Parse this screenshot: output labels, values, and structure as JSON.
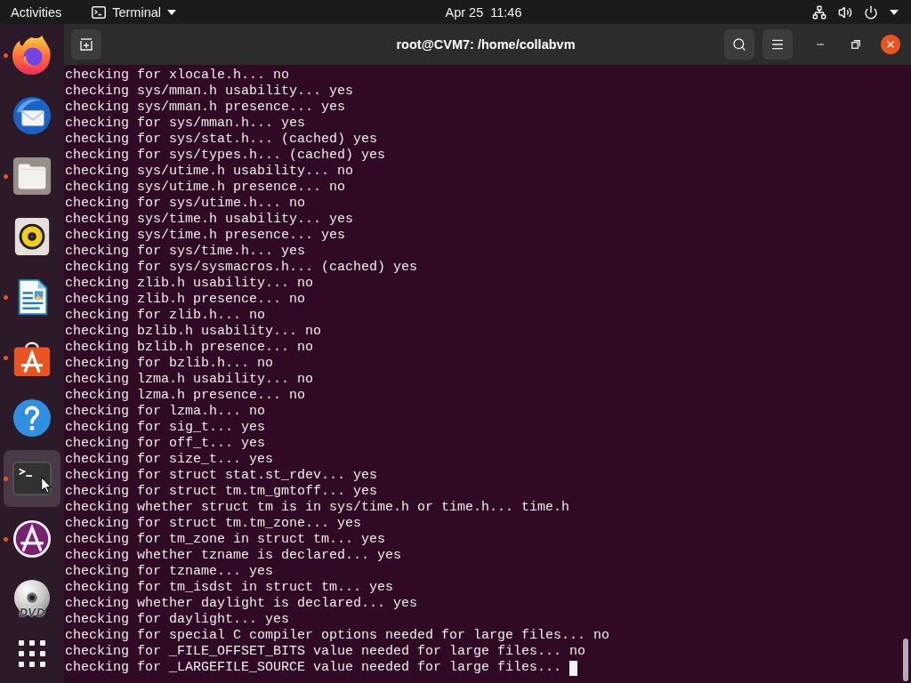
{
  "top_bar": {
    "activities": "Activities",
    "app_menu": "Terminal",
    "clock": "Apr 25  11:46"
  },
  "dock": {
    "items": [
      {
        "kind": "browser",
        "running": true,
        "selected": false
      },
      {
        "kind": "mail",
        "running": false,
        "selected": false
      },
      {
        "kind": "folder",
        "running": true,
        "selected": false
      },
      {
        "kind": "speaker",
        "running": false,
        "selected": false
      },
      {
        "kind": "document",
        "running": true,
        "selected": false
      },
      {
        "kind": "shop",
        "running": true,
        "selected": false
      },
      {
        "kind": "help",
        "running": false,
        "selected": false
      },
      {
        "kind": "terminal",
        "running": true,
        "selected": true
      },
      {
        "kind": "emblem",
        "running": true,
        "selected": false
      },
      {
        "kind": "disc",
        "running": false,
        "selected": false,
        "label": "DVD"
      }
    ]
  },
  "window": {
    "title": "root@CVM7: /home/collabvm"
  },
  "terminal": {
    "lines": [
      "checking for xlocale.h... no",
      "checking sys/mman.h usability... yes",
      "checking sys/mman.h presence... yes",
      "checking for sys/mman.h... yes",
      "checking for sys/stat.h... (cached) yes",
      "checking for sys/types.h... (cached) yes",
      "checking sys/utime.h usability... no",
      "checking sys/utime.h presence... no",
      "checking for sys/utime.h... no",
      "checking sys/time.h usability... yes",
      "checking sys/time.h presence... yes",
      "checking for sys/time.h... yes",
      "checking for sys/sysmacros.h... (cached) yes",
      "checking zlib.h usability... no",
      "checking zlib.h presence... no",
      "checking for zlib.h... no",
      "checking bzlib.h usability... no",
      "checking bzlib.h presence... no",
      "checking for bzlib.h... no",
      "checking lzma.h usability... no",
      "checking lzma.h presence... no",
      "checking for lzma.h... no",
      "checking for sig_t... yes",
      "checking for off_t... yes",
      "checking for size_t... yes",
      "checking for struct stat.st_rdev... yes",
      "checking for struct tm.tm_gmtoff... yes",
      "checking whether struct tm is in sys/time.h or time.h... time.h",
      "checking for struct tm.tm_zone... yes",
      "checking for tm_zone in struct tm... yes",
      "checking whether tzname is declared... yes",
      "checking for tzname... yes",
      "checking for tm_isdst in struct tm... yes",
      "checking whether daylight is declared... yes",
      "checking for daylight... yes",
      "checking for special C compiler options needed for large files... no",
      "checking for _FILE_OFFSET_BITS value needed for large files... no",
      "checking for _LARGEFILE_SOURCE value needed for large files..."
    ],
    "cursor": true
  }
}
